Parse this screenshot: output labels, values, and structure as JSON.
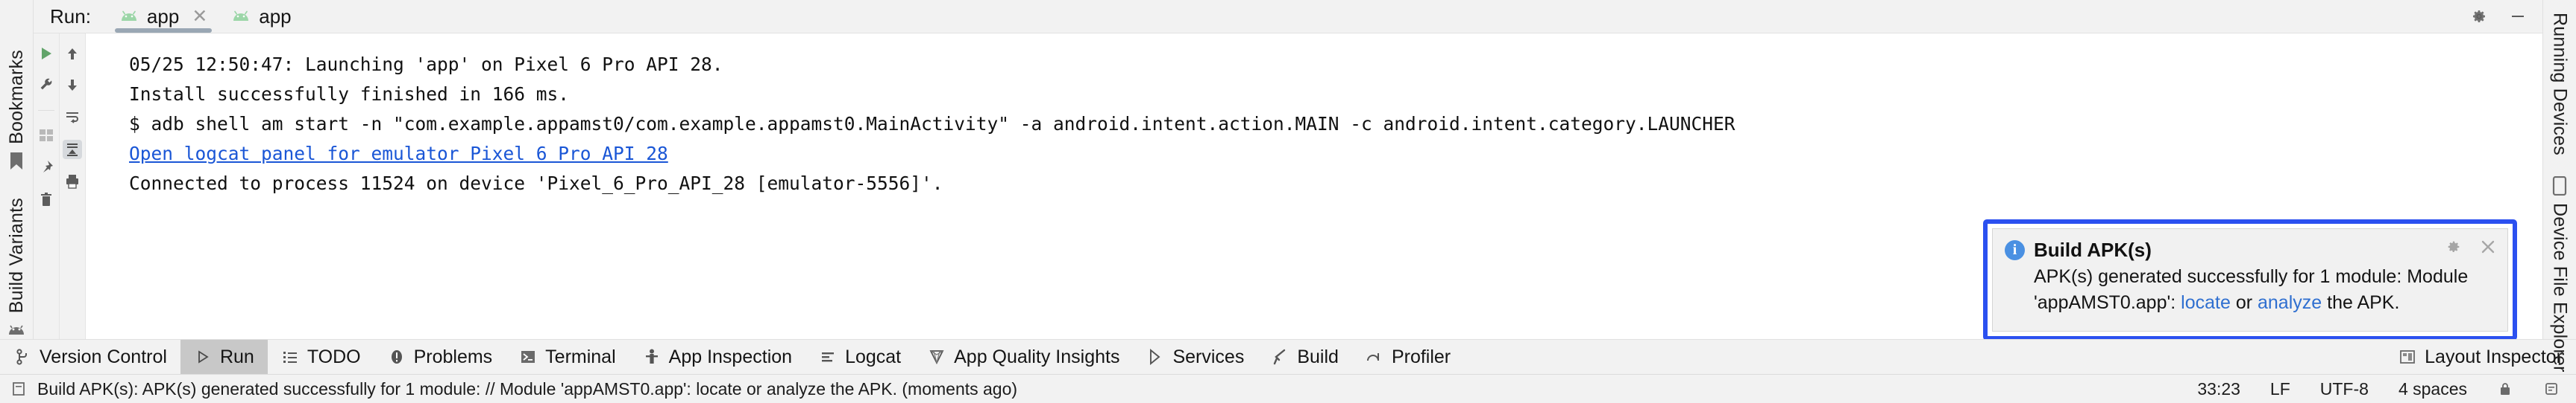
{
  "window": {
    "run_label": "Run:",
    "header_buttons": [
      {
        "name": "settings",
        "icon": "gear-icon"
      },
      {
        "name": "minimize",
        "icon": "minimize-icon"
      }
    ],
    "tabs": [
      {
        "label": "app",
        "icon": "android-icon",
        "closable": true,
        "active": true
      },
      {
        "label": "app",
        "icon": "android-icon",
        "closable": false,
        "active": false
      }
    ]
  },
  "left_strip": {
    "items": [
      {
        "label": "Bookmarks",
        "icon": "bookmark-icon"
      },
      {
        "label": "Build Variants",
        "icon": "android-variant-icon"
      }
    ]
  },
  "right_strip": {
    "items": [
      {
        "label": "Running Devices",
        "icon": "device-screen-icon"
      },
      {
        "label": "Device File Explorer",
        "icon": "phone-icon"
      }
    ]
  },
  "left_toolbar": {
    "column_one": [
      {
        "name": "rerun-button",
        "icon": "play-icon"
      },
      {
        "name": "edit-configuration-button",
        "icon": "wrench-icon"
      },
      {
        "name": "layout-button",
        "icon": "layout-icon"
      },
      {
        "name": "pin-tab-button",
        "icon": "pin-icon"
      },
      {
        "name": "delete-button",
        "icon": "trash-icon"
      }
    ],
    "column_two": [
      {
        "name": "up-button",
        "icon": "arrow-up-icon"
      },
      {
        "name": "down-button",
        "icon": "arrow-down-icon"
      },
      {
        "name": "soft-wrap-button",
        "icon": "wrap-icon"
      },
      {
        "name": "scroll-to-end-button",
        "icon": "scroll-end-icon"
      },
      {
        "name": "print-button",
        "icon": "print-icon"
      }
    ]
  },
  "console": {
    "lines": [
      {
        "text": "05/25 12:50:47: Launching 'app' on Pixel 6 Pro API 28.",
        "link": false
      },
      {
        "text": "Install successfully finished in 166 ms.",
        "link": false
      },
      {
        "text": "$ adb shell am start -n \"com.example.appamst0/com.example.appamst0.MainActivity\" -a android.intent.action.MAIN -c android.intent.category.LAUNCHER",
        "link": false
      },
      {
        "text": "Open logcat panel for emulator Pixel 6 Pro API 28",
        "link": true
      },
      {
        "text": "Connected to process 11524 on device 'Pixel_6_Pro_API_28 [emulator-5556]'.",
        "link": false
      }
    ]
  },
  "notification": {
    "title": "Build APK(s)",
    "info_glyph": "i",
    "body_prefix": "APK(s) generated successfully for 1 module: Module 'appAMST0.app': ",
    "link_locate": "locate",
    "body_middle": " or ",
    "link_analyze": "analyze",
    "body_suffix": " the APK.",
    "border_color": "#2b50f0",
    "link_color": "#2f6fd0",
    "actions": [
      {
        "name": "notification-settings",
        "icon": "gear-icon",
        "glyph": "⚙"
      },
      {
        "name": "notification-close",
        "icon": "close-icon",
        "glyph": "✕"
      }
    ]
  },
  "bottom_tabs": [
    {
      "label": "Version Control",
      "icon": "branch-icon",
      "active": false
    },
    {
      "label": "Run",
      "icon": "play-icon",
      "active": true
    },
    {
      "label": "TODO",
      "icon": "list-icon",
      "active": false
    },
    {
      "label": "Problems",
      "icon": "error-icon",
      "active": false
    },
    {
      "label": "Terminal",
      "icon": "terminal-icon",
      "active": false
    },
    {
      "label": "App Inspection",
      "icon": "inspection-icon",
      "active": false
    },
    {
      "label": "Logcat",
      "icon": "logcat-icon",
      "active": false
    },
    {
      "label": "App Quality Insights",
      "icon": "gem-icon",
      "active": false
    },
    {
      "label": "Services",
      "icon": "services-icon",
      "active": false
    },
    {
      "label": "Build",
      "icon": "hammer-icon",
      "active": false
    },
    {
      "label": "Profiler",
      "icon": "profiler-icon",
      "active": false
    }
  ],
  "bottom_right": {
    "label": "Layout Inspector",
    "icon": "layout-inspector-icon"
  },
  "status_bar": {
    "message": "Build APK(s): APK(s) generated successfully for 1 module: // Module 'appAMST0.app': locate or analyze the APK. (moments ago)",
    "message_icon": "notification-icon",
    "caret_position": "33:23",
    "line_separator": "LF",
    "encoding": "UTF-8",
    "indent": "4 spaces",
    "lock_icon": "lock-icon",
    "events_icon": "events-icon"
  }
}
